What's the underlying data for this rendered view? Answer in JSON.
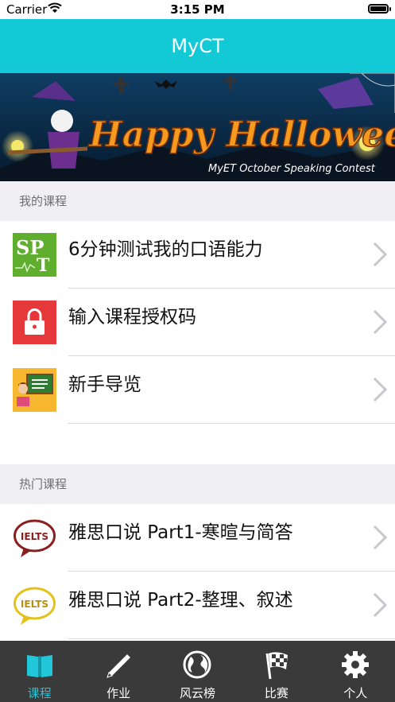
{
  "status": {
    "carrier": "Carrier",
    "time": "3:15 PM"
  },
  "nav": {
    "title": "MyCT"
  },
  "banner": {
    "headline": "Happy Halloween",
    "subline": "MyET October Speaking Contest"
  },
  "my_courses": {
    "header": "我的课程",
    "items": [
      {
        "label": "6分钟测试我的口语能力",
        "icon": "spt-icon"
      },
      {
        "label": "输入课程授权码",
        "icon": "lock-icon"
      },
      {
        "label": "新手导览",
        "icon": "tutorial-icon"
      }
    ]
  },
  "hot_courses": {
    "header": "热门课程",
    "items": [
      {
        "label": "雅思口说 Part1-寒暄与简答",
        "icon": "ielts-red-icon"
      },
      {
        "label": "雅思口说 Part2-整理、叙述",
        "icon": "ielts-yellow-icon"
      }
    ]
  },
  "tabs": [
    {
      "label": "课程",
      "icon": "book-icon",
      "active": true
    },
    {
      "label": "作业",
      "icon": "pencil-icon",
      "active": false
    },
    {
      "label": "风云榜",
      "icon": "globe-icon",
      "active": false
    },
    {
      "label": "比赛",
      "icon": "checkered-flag-icon",
      "active": false
    },
    {
      "label": "个人",
      "icon": "gear-icon",
      "active": false
    }
  ],
  "colors": {
    "accent": "#14c9d6",
    "tab_active": "#22c6d9",
    "tabbar": "#3a3a3a"
  }
}
